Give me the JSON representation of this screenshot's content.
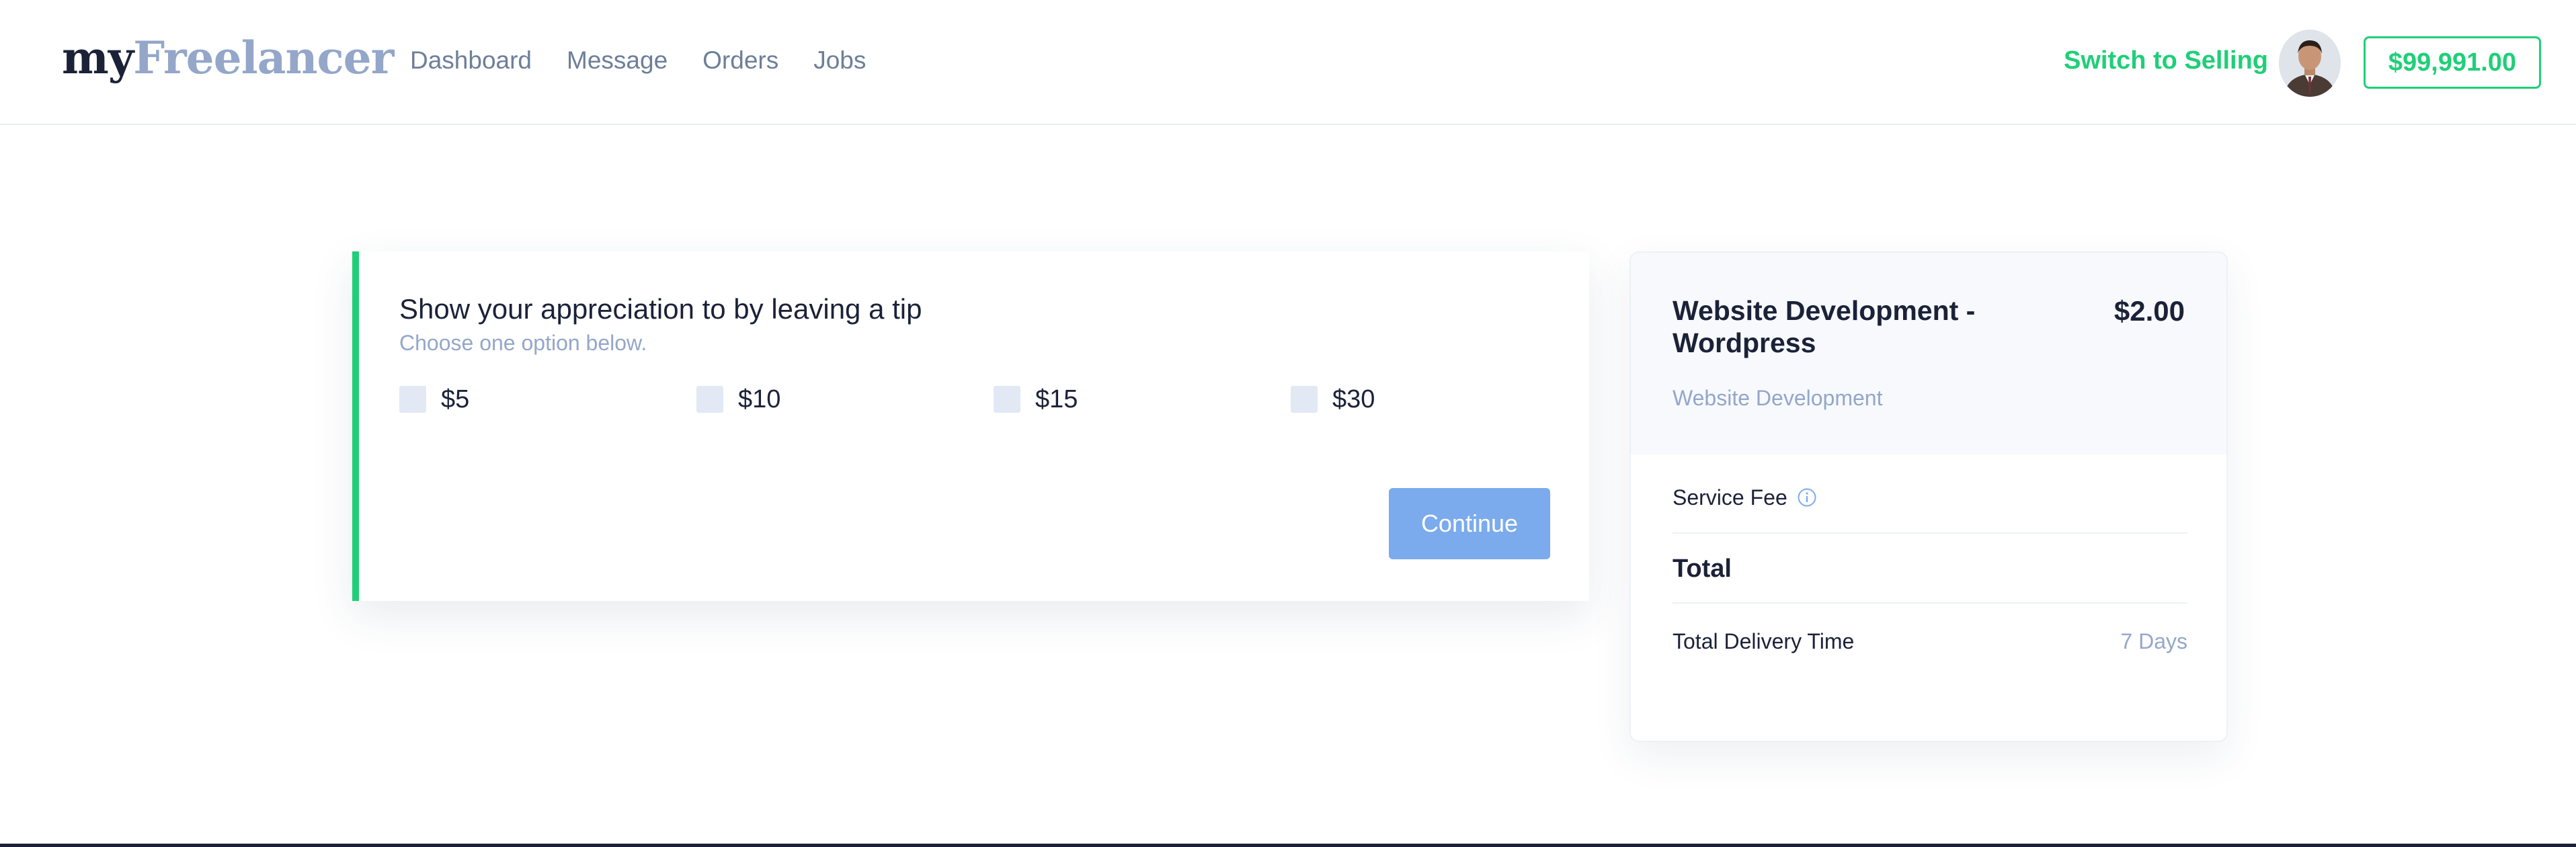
{
  "logo": {
    "part1": "my",
    "part2": "Freelancer"
  },
  "nav": {
    "items": [
      {
        "label": "Dashboard"
      },
      {
        "label": "Message"
      },
      {
        "label": "Orders"
      },
      {
        "label": "Jobs"
      }
    ]
  },
  "header": {
    "switch_label": "Switch to Selling",
    "balance": "$99,991.00",
    "avatar_icon": "user-avatar"
  },
  "tip": {
    "title": "Show your appreciation to by leaving a tip",
    "subtitle": "Choose one option below.",
    "options": [
      {
        "label": "$5",
        "checked": false
      },
      {
        "label": "$10",
        "checked": false
      },
      {
        "label": "$15",
        "checked": false
      },
      {
        "label": "$30",
        "checked": false
      }
    ],
    "continue_label": "Continue"
  },
  "summary": {
    "service_title": "Website Development - Wordpress",
    "price": "$2.00",
    "category": "Website Development",
    "service_fee_label": "Service Fee",
    "total_label": "Total",
    "delivery_label": "Total Delivery Time",
    "delivery_value": "7 Days"
  },
  "colors": {
    "accent_green": "#1fcf78",
    "button_blue": "#7babec",
    "muted_text": "#94a7c9",
    "dark_text": "#1b2238"
  }
}
